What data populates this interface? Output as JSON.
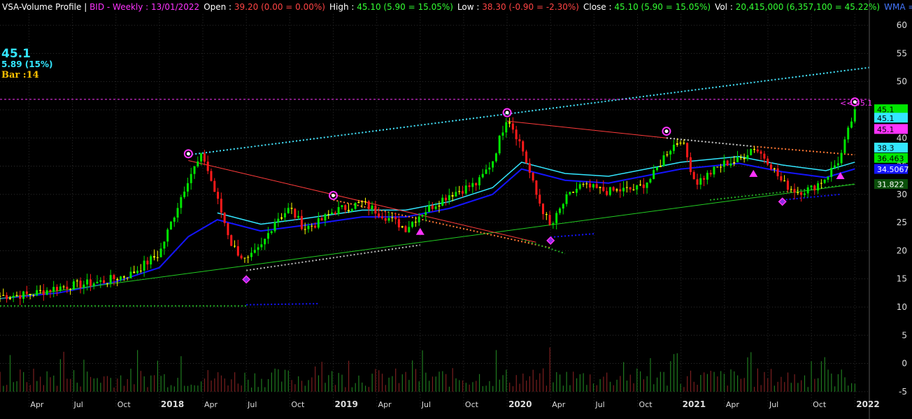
{
  "header": {
    "title": "VSA-Volume Profile",
    "sep1": " | ",
    "symbol_info": "BID - Weekly : 13/01/2022",
    "open_label": "Open : ",
    "open_value": "39.20 (0.00 = 0.00%)",
    "high_label": "High : ",
    "high_value": "45.10 (5.90 = 15.05%)",
    "low_label": "Low : ",
    "low_value": "38.30 (-0.90 = -2.30%)",
    "close_label": "Close : ",
    "close_value": "45.10 (5.90 = 15.05%)",
    "vol_label": "Vol : ",
    "vol_value": "20,415,000 (6,357,100 = 45.22%)",
    "wma_text": "WMA = 34.51,",
    "extra": "H"
  },
  "info": {
    "price": "45.1",
    "change": "5.89 (15%)",
    "bar": "Bar :14"
  },
  "price_marker": "<< 45.1",
  "colors": {
    "bull": "#00e600",
    "bear": "#ff1a1a",
    "neutral": "#ffff00",
    "wma": "#1414ff",
    "ma_short": "#33e6ff",
    "trend_green": "#22cc22",
    "channel_cyan": "#44e6ff",
    "resistance_red": "#ff3b3b",
    "magenta": "#ff33ff"
  },
  "chart_data": {
    "type": "candlestick",
    "y_axis": {
      "range": [
        -8,
        62
      ],
      "ticks": [
        -5,
        0,
        5,
        10,
        15,
        20,
        25,
        30,
        35,
        40,
        45,
        50,
        55,
        60
      ]
    },
    "x_axis": {
      "range": [
        "2017-02",
        "2022-02"
      ],
      "ticks": [
        "Apr",
        "Jul",
        "Oct",
        "2018",
        "Apr",
        "Jul",
        "Oct",
        "2019",
        "Apr",
        "Jul",
        "Oct",
        "2020",
        "Apr",
        "Jul",
        "Oct",
        "2021",
        "Apr",
        "Jul",
        "Oct",
        "2022"
      ]
    },
    "price_tags": [
      {
        "value": "45.1",
        "price": 45.1,
        "bg": "#00e600",
        "fg": "#000000"
      },
      {
        "value": "45.1",
        "price": 43.6,
        "bg": "#33e6ff",
        "fg": "#000000"
      },
      {
        "value": "45.1",
        "price": 41.6,
        "bg": "#ff33ff",
        "fg": "#000000"
      },
      {
        "value": "38.3",
        "price": 38.3,
        "bg": "#33e6ff",
        "fg": "#000000"
      },
      {
        "value": "36.463",
        "price": 36.463,
        "bg": "#00e600",
        "fg": "#000000"
      },
      {
        "value": "34.5067",
        "price": 34.5067,
        "bg": "#1414ff",
        "fg": "#ffffff"
      },
      {
        "value": "31.822",
        "price": 31.822,
        "bg": "#0a4f0a",
        "fg": "#ffffff"
      }
    ],
    "price_path": [
      [
        "2017-02",
        12.0
      ],
      [
        "2017-04",
        12.2
      ],
      [
        "2017-06",
        13.5
      ],
      [
        "2017-09",
        14.5
      ],
      [
        "2017-11",
        15.8
      ],
      [
        "2018-01",
        19.5
      ],
      [
        "2018-03",
        33.0
      ],
      [
        "2018-04",
        37.0
      ],
      [
        "2018-05",
        29.0
      ],
      [
        "2018-06",
        21.0
      ],
      [
        "2018-07",
        18.0
      ],
      [
        "2018-08",
        20.5
      ],
      [
        "2018-09",
        25.5
      ],
      [
        "2018-10",
        27.5
      ],
      [
        "2018-11",
        24.0
      ],
      [
        "2018-12",
        25.0
      ],
      [
        "2019-01",
        27.0
      ],
      [
        "2019-03",
        28.5
      ],
      [
        "2019-05",
        25.5
      ],
      [
        "2019-06",
        24.0
      ],
      [
        "2019-07",
        26.5
      ],
      [
        "2019-09",
        30.0
      ],
      [
        "2019-11",
        32.0
      ],
      [
        "2019-12",
        36.0
      ],
      [
        "2020-01",
        44.0
      ],
      [
        "2020-02",
        38.5
      ],
      [
        "2020-03",
        30.0
      ],
      [
        "2020-04",
        24.0
      ],
      [
        "2020-05",
        29.0
      ],
      [
        "2020-06",
        31.5
      ],
      [
        "2020-08",
        30.5
      ],
      [
        "2020-10",
        31.0
      ],
      [
        "2020-11",
        33.0
      ],
      [
        "2020-12",
        37.5
      ],
      [
        "2021-01",
        40.0
      ],
      [
        "2021-02",
        32.0
      ],
      [
        "2021-04",
        35.5
      ],
      [
        "2021-05",
        36.0
      ],
      [
        "2021-06",
        38.5
      ],
      [
        "2021-07",
        36.0
      ],
      [
        "2021-08",
        32.0
      ],
      [
        "2021-09",
        30.5
      ],
      [
        "2021-10",
        31.0
      ],
      [
        "2021-11",
        33.0
      ],
      [
        "2021-12",
        36.5
      ],
      [
        "2022-01",
        45.1
      ]
    ],
    "wma_path": [
      [
        "2017-02",
        11.5
      ],
      [
        "2017-06",
        12.5
      ],
      [
        "2017-10",
        14.5
      ],
      [
        "2018-01",
        17.0
      ],
      [
        "2018-03",
        22.5
      ],
      [
        "2018-05",
        25.5
      ],
      [
        "2018-08",
        23.5
      ],
      [
        "2018-11",
        24.5
      ],
      [
        "2019-03",
        26.0
      ],
      [
        "2019-06",
        26.0
      ],
      [
        "2019-09",
        27.5
      ],
      [
        "2019-12",
        30.0
      ],
      [
        "2020-02",
        34.5
      ],
      [
        "2020-05",
        32.5
      ],
      [
        "2020-08",
        32.0
      ],
      [
        "2020-11",
        33.5
      ],
      [
        "2021-01",
        34.5
      ],
      [
        "2021-05",
        35.5
      ],
      [
        "2021-08",
        34.0
      ],
      [
        "2021-11",
        33.0
      ],
      [
        "2022-01",
        34.51
      ]
    ],
    "trendlines": [
      {
        "type": "channel_upper",
        "from": [
          "2018-03",
          37.0
        ],
        "to": [
          "2022-02",
          52.5
        ],
        "color": "#44e6ff"
      },
      {
        "type": "support",
        "from": [
          "2017-02",
          11.5
        ],
        "to": [
          "2022-01",
          31.8
        ],
        "color": "#22cc22"
      },
      {
        "type": "resistance",
        "from": [
          "2018-03",
          36.0
        ],
        "to": [
          "2020-03",
          21.5
        ],
        "color": "#ff3b3b"
      },
      {
        "type": "resistance",
        "from": [
          "2020-01",
          43.0
        ],
        "to": [
          "2020-12",
          40.0
        ],
        "color": "#ff3b3b"
      }
    ],
    "markers": {
      "tops": [
        [
          "2018-03",
          37.2
        ],
        [
          "2019-01",
          29.8
        ],
        [
          "2020-01",
          44.5
        ],
        [
          "2020-12",
          41.2
        ],
        [
          "2022-01",
          46.4
        ]
      ],
      "bottoms": [
        [
          "2018-07",
          14.9
        ],
        [
          "2020-04",
          21.8
        ],
        [
          "2021-08",
          28.7
        ]
      ],
      "up_triangles": [
        [
          "2019-07",
          23.3
        ],
        [
          "2021-06",
          33.6
        ],
        [
          "2021-12",
          33.2
        ]
      ]
    }
  }
}
